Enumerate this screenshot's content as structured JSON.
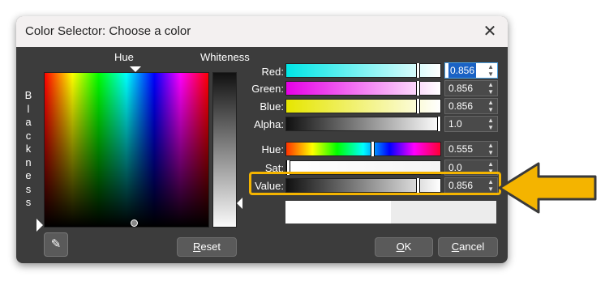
{
  "window": {
    "title": "Color Selector: Choose a color",
    "close_glyph": "✕"
  },
  "labels": {
    "hue": "Hue",
    "whiteness": "Whiteness",
    "blackness_letters": [
      "B",
      "l",
      "a",
      "c",
      "k",
      "n",
      "e",
      "s",
      "s"
    ]
  },
  "channels": [
    {
      "label": "Red:",
      "value": "0.856",
      "focused": true
    },
    {
      "label": "Green:",
      "value": "0.856",
      "focused": false
    },
    {
      "label": "Blue:",
      "value": "0.856",
      "focused": false
    },
    {
      "label": "Alpha:",
      "value": "1.0",
      "focused": false
    },
    {
      "label": "Hue:",
      "value": "0.555",
      "focused": false
    },
    {
      "label": "Sat:",
      "value": "0.0",
      "focused": false
    },
    {
      "label": "Value:",
      "value": "0.856",
      "focused": false
    }
  ],
  "buttons": {
    "reset_prefix": "R",
    "reset_rest": "eset",
    "ok_prefix": "O",
    "ok_rest": "K",
    "cancel_prefix": "C",
    "cancel_rest": "ancel",
    "eyedropper_glyph": "✎"
  },
  "spinner_glyph": "▲\n▼",
  "colors": {
    "highlight": "#f4b400",
    "arrow": "#f4b400",
    "current_color": "#ffffff",
    "previous_color": "#ececec"
  },
  "icons": [
    "close-icon",
    "eyedropper-icon",
    "callout-arrow-icon"
  ]
}
